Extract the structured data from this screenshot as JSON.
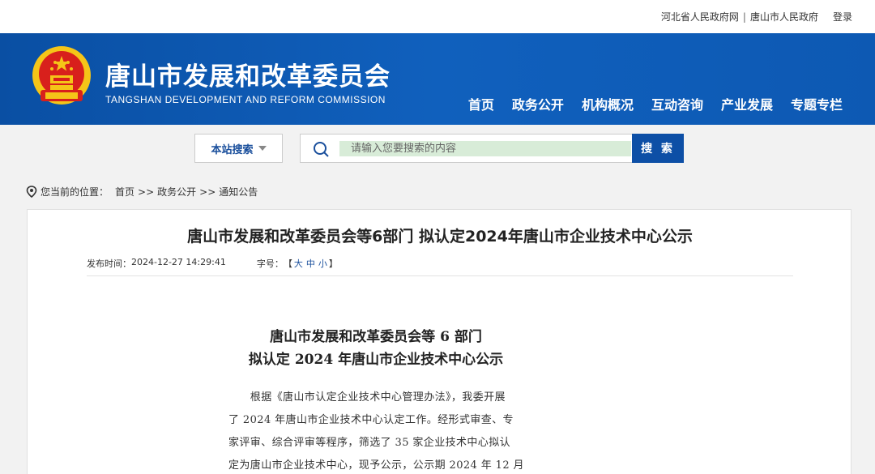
{
  "topbar": {
    "links": [
      "河北省人民政府网",
      "唐山市人民政府"
    ],
    "separator": "|",
    "login": "登录"
  },
  "header": {
    "title": "唐山市发展和改革委员会",
    "subtitle": "TANGSHAN DEVELOPMENT AND REFORM COMMISSION",
    "nav": [
      "首页",
      "政务公开",
      "机构概况",
      "互动咨询",
      "产业发展",
      "专题专栏"
    ]
  },
  "search": {
    "scope": "本站搜索",
    "placeholder": "请输入您要搜索的内容",
    "button": "搜 索"
  },
  "breadcrumb": {
    "prefix": "您当前的位置：",
    "items": [
      "首页",
      "政务公开",
      "通知公告"
    ],
    "arrow": ">>"
  },
  "article": {
    "title": "唐山市发展和改革委员会等6部门 拟认定2024年唐山市企业技术中心公示",
    "published_label": "发布时间：",
    "published": "2024-12-27 14:29:41",
    "fontsize_label": "字号：",
    "fontsize_open": "【",
    "fontsize_options": [
      "大",
      "中",
      "小"
    ],
    "fontsize_close": "】",
    "doc_title_line1": "唐山市发展和改革委员会等 6 部门",
    "doc_title_line2": "拟认定 2024 年唐山市企业技术中心公示",
    "body_lines": [
      "　　根据《唐山市认定企业技术中心管理办法》，我委开展",
      "了 2024 年唐山市企业技术中心认定工作。经形式审查、专",
      "家评审、综合评审等程序，筛选了 35 家企业技术中心拟认",
      "定为唐山市企业技术中心，现予公示，公示期 2024 年 12 月"
    ]
  },
  "colors": {
    "header_blue": "#0d59b3",
    "button_blue": "#0d4fa6",
    "emblem_red": "#d8201c",
    "emblem_gold": "#f5c518"
  }
}
